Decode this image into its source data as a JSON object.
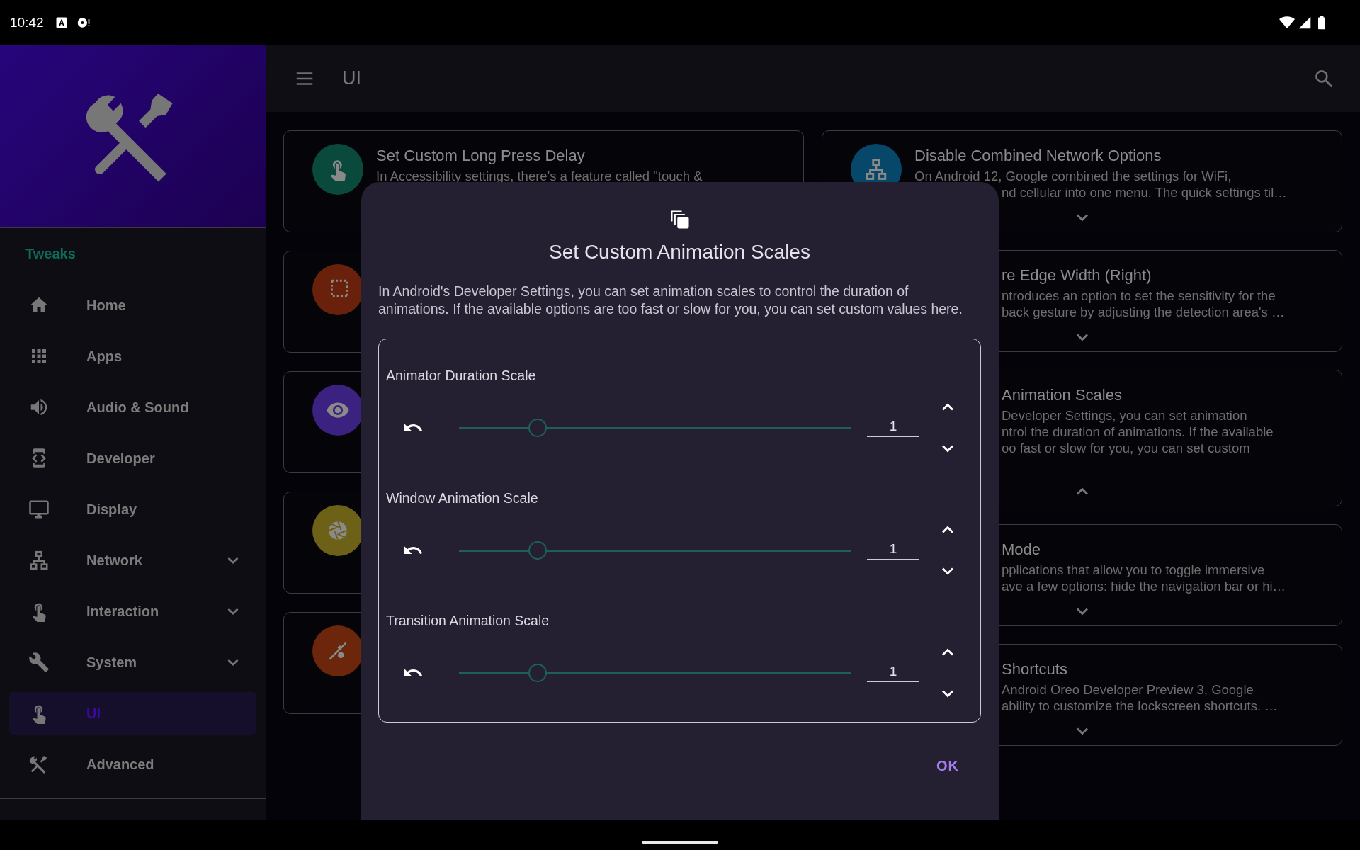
{
  "status_bar": {
    "time": "10:42"
  },
  "drawer": {
    "section": "Tweaks",
    "items": [
      {
        "label": "Home",
        "expandable": false,
        "selected": false
      },
      {
        "label": "Apps",
        "expandable": false,
        "selected": false
      },
      {
        "label": "Audio & Sound",
        "expandable": false,
        "selected": false
      },
      {
        "label": "Developer",
        "expandable": false,
        "selected": false
      },
      {
        "label": "Display",
        "expandable": false,
        "selected": false
      },
      {
        "label": "Network",
        "expandable": true,
        "selected": false
      },
      {
        "label": "Interaction",
        "expandable": true,
        "selected": false
      },
      {
        "label": "System",
        "expandable": true,
        "selected": false
      },
      {
        "label": "UI",
        "expandable": false,
        "selected": true
      },
      {
        "label": "Advanced",
        "expandable": false,
        "selected": false
      }
    ]
  },
  "toolbar": {
    "title": "UI"
  },
  "cards": {
    "left": [
      {
        "color": "#0a4a3d",
        "title": "Set Custom Long Press Delay",
        "lines": [
          {
            "text": "In Accessibility settings, there's a feature called \"touch &",
            "covered": false
          }
        ]
      },
      {
        "color": "#6a210b"
      },
      {
        "color": "#3b2180"
      },
      {
        "color": "#6d6118"
      },
      {
        "color": "#6b260c"
      }
    ],
    "right": [
      {
        "color": "#07486a",
        "title": "Disable Combined Network Options",
        "covered": false,
        "expanded": false,
        "lines": [
          {
            "text": "On Android 12, Google combined the settings for WiFi,",
            "covered": false
          },
          {
            "text": "nd cellular into one menu. The quick settings til…",
            "covered": true
          }
        ]
      },
      {
        "title": "re Edge Width (Right)",
        "covered": true,
        "expanded": false,
        "lines": [
          {
            "text": "ntroduces an option to set the sensitivity for the",
            "covered": true
          },
          {
            "text": "back gesture by adjusting the detection area's …",
            "covered": true
          }
        ]
      },
      {
        "title": "Animation Scales",
        "covered": true,
        "expanded": true,
        "lines": [
          {
            "text": "Developer Settings, you can set animation",
            "covered": true
          },
          {
            "text": "ntrol the duration of animations. If the available",
            "covered": true
          },
          {
            "text": "oo fast or slow for you, you can set custom",
            "covered": true
          }
        ]
      },
      {
        "title": "Mode",
        "covered": true,
        "expanded": false,
        "lines": [
          {
            "text": "pplications that allow you to toggle immersive",
            "covered": true
          },
          {
            "text": "ave a few options: hide the navigation bar or hi…",
            "covered": true
          }
        ]
      },
      {
        "title": "Shortcuts",
        "covered": true,
        "expanded": false,
        "lines": [
          {
            "text": "Android Oreo Developer Preview 3, Google",
            "covered": true
          },
          {
            "text": "ability to customize the lockscreen shortcuts. …",
            "covered": true
          }
        ]
      }
    ]
  },
  "dialog": {
    "title": "Set Custom Animation Scales",
    "message": "In Android's Developer Settings, you can set animation scales to control the duration of animations. If the available options are too fast or slow for you, you can set custom values here.",
    "rows": [
      {
        "label": "Animator Duration Scale",
        "level": 0.2,
        "value": "1"
      },
      {
        "label": "Window Animation Scale",
        "level": 0.2,
        "value": "1"
      },
      {
        "label": "Transition Animation Scale",
        "level": 0.2,
        "value": "1"
      }
    ],
    "ok": "OK"
  }
}
